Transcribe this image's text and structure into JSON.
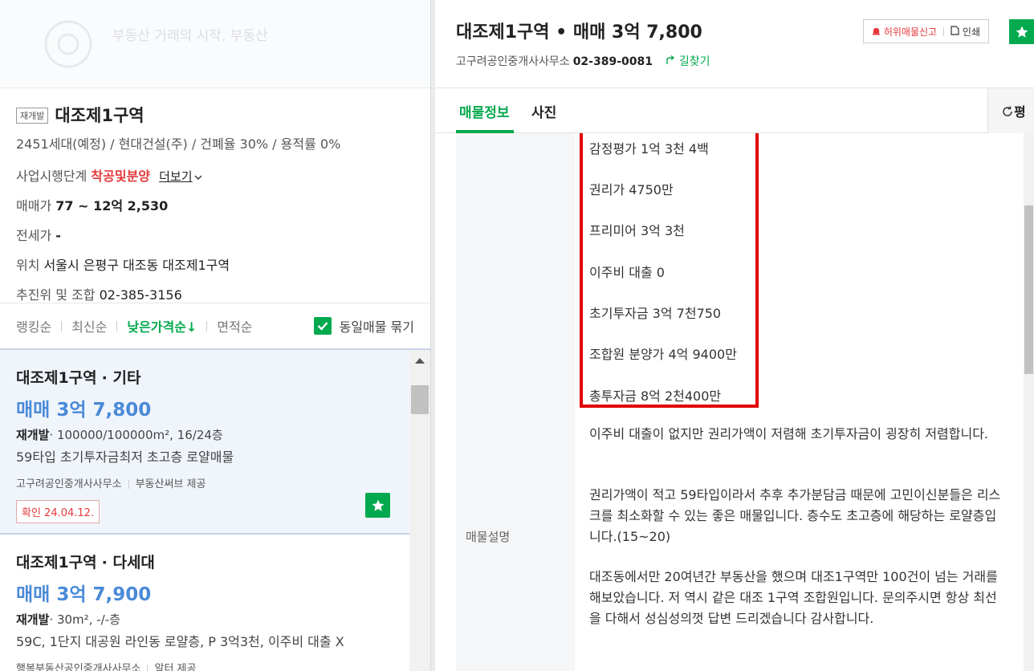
{
  "left": {
    "faded_brand_text": "부동산 거래의 시작, 부동산",
    "complex": {
      "tag": "재개발",
      "name": "대조제1구역",
      "summary": "2451세대(예정) / 현대건설(주) / 건폐율 30% / 용적률 0%",
      "stage_label": "사업시행단계",
      "stage_value": "착공및분양",
      "more_label": "더보기",
      "price_label": "매매가",
      "price_value": "77 ~ 12억 2,530",
      "jeonse_label": "전세가",
      "jeonse_value": "-",
      "location_label": "위치",
      "location_value": "서울시 은평구 대조동 대조제1구역",
      "union_label": "추진위 및 조합",
      "union_value": "02-385-3156"
    },
    "sort": {
      "items": [
        "랭킹순",
        "최신순",
        "낮은가격순↓",
        "면적순"
      ],
      "group_label": "동일매물 묶기"
    },
    "listings": [
      {
        "title": "대조제1구역",
        "type": "· 기타",
        "price": "매매 3억 7,800",
        "spec_bold": "재개발",
        "spec_rest": "· 100000/100000m², 16/24층",
        "desc": "59타입 초기투자금최저 초고층 로얄매물",
        "agent": "고구려공인중개사사무소",
        "provider": "부동산써브 제공",
        "confirm": "확인 24.04.12."
      },
      {
        "title": "대조제1구역",
        "type": "· 다세대",
        "price": "매매 3억 7,900",
        "spec_bold": "재개발",
        "spec_rest": "· 30m², -/-층",
        "desc": "59C, 1단지 대공원 라인동 로얄층, P 3억3천, 이주비 대출 X",
        "agent": "행복부동산공인중개사사무소",
        "provider": "알터 제공"
      }
    ]
  },
  "detail": {
    "title": "대조제1구역 • 매매 3억 7,800",
    "agency": "고구려공인중개사사무소",
    "phone": "02-389-0081",
    "route_label": "길찾기",
    "report_label": "허위매물신고",
    "print_label": "인쇄",
    "tabs": [
      "매물정보",
      "사진"
    ],
    "refresh_label": "평",
    "desc_label": "매물설명",
    "financials": [
      "감정평가 1억 3천 4백",
      "권리가 4750만",
      "프리미어 3억 3천",
      "이주비 대출 0",
      "초기투자금 3억 7천750",
      "조합원 분양가 4억 9400만",
      "총투자금 8억 2천400만"
    ],
    "paragraphs": [
      "이주비 대출이 없지만 권리가액이 저렴해 초기투자금이 굉장히 저렴합니다.",
      "권리가액이 적고 59타입이라서 추후 추가분담금 때문에 고민이신분들은 리스크를 최소화할 수 있는 좋은 매물입니다. 층수도 초고층에 해당하는 로얄층입니다.(15~20)",
      "대조동에서만 20여년간 부동산을 했으며 대조1구역만 100건이 넘는 거래를 해보았습니다. 저 역시 같은 대조 1구역 조합원입니다. 문의주시면 항상 최선을 다해서 성심성의껏 답변 드리겠습니다 감사합니다."
    ]
  },
  "colors": {
    "accent_green": "#03a94e",
    "price_blue": "#4a8ad8",
    "alert_red": "#e5383b",
    "highlight_red": "#e00000"
  }
}
